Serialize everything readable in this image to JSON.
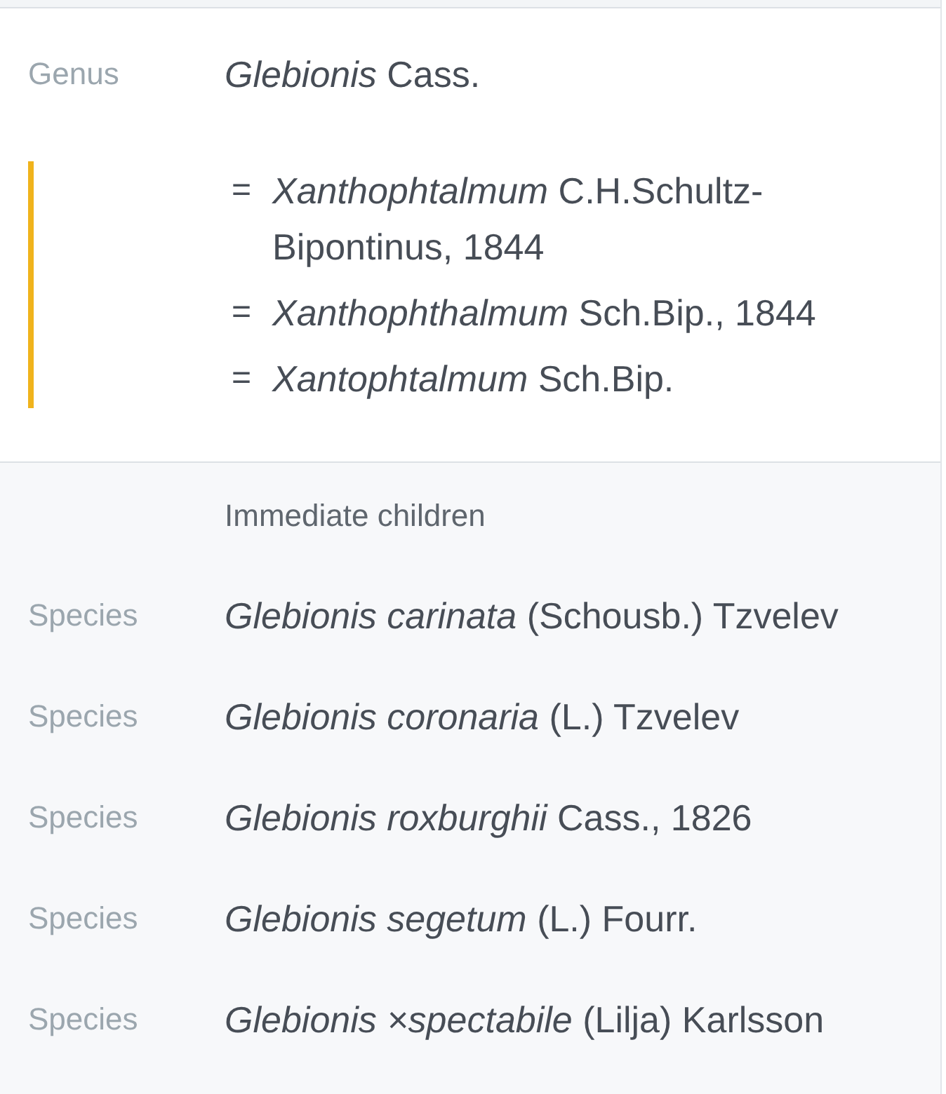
{
  "taxon": {
    "rank": "Genus",
    "name": "*Glebionis* Cass.",
    "synonyms": [
      {
        "symbol": "=",
        "name": "*Xanthophtalmum* C.H.Schultz-Bipontinus, 1844"
      },
      {
        "symbol": "=",
        "name": "*Xanthophthalmum* Sch.Bip., 1844"
      },
      {
        "symbol": "=",
        "name": "*Xantophtalmum* Sch.Bip."
      }
    ]
  },
  "children": {
    "heading": "Immediate children",
    "items": [
      {
        "rank": "Species",
        "name": "*Glebionis carinata* (Schousb.) Tzvelev"
      },
      {
        "rank": "Species",
        "name": "*Glebionis coronaria* (L.) Tzvelev"
      },
      {
        "rank": "Species",
        "name": "*Glebionis roxburghii* Cass., 1826"
      },
      {
        "rank": "Species",
        "name": "*Glebionis segetum* (L.) Fourr."
      },
      {
        "rank": "Species",
        "name": "*Glebionis ×spectabile* (Lilja) Karlsson"
      }
    ]
  }
}
